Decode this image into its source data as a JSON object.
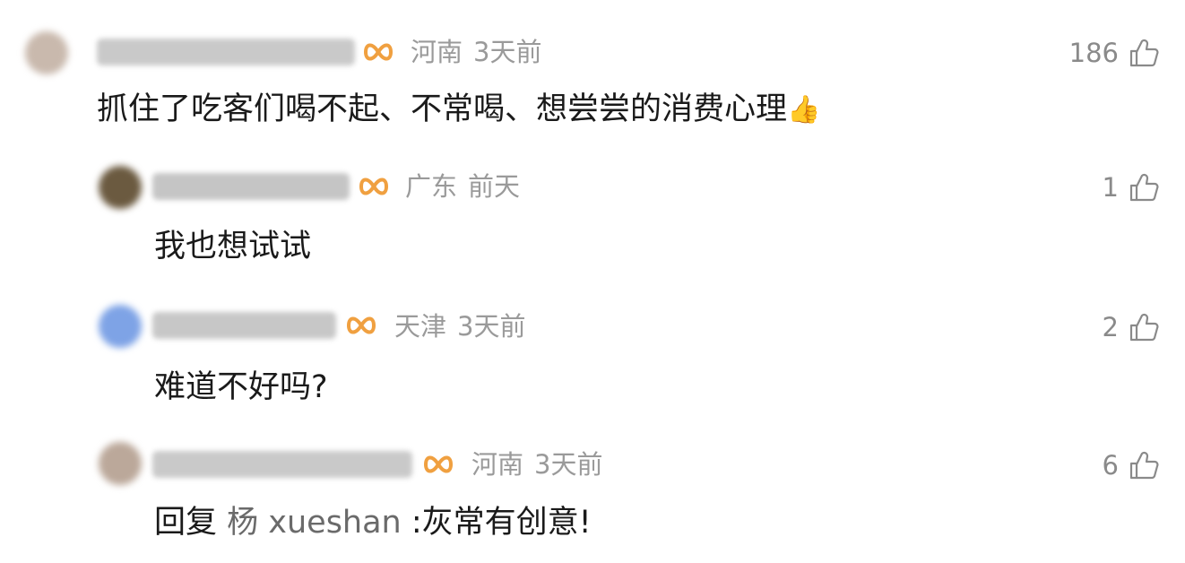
{
  "comments": [
    {
      "location": "河南",
      "time": "3天前",
      "likes": "186",
      "text": "抓住了吃客们喝不起、不常喝、想尝尝的消费心理",
      "emoji": "👍",
      "avatar_color": "#c9b9ad",
      "nick_color": "#b8b8b8"
    },
    {
      "location": "广东",
      "time": "前天",
      "likes": "1",
      "text": "我也想试试",
      "avatar_color": "#6b5a40",
      "nick_color": "#b2b2b2"
    },
    {
      "location": "天津",
      "time": "3天前",
      "likes": "2",
      "text": "难道不好吗?",
      "avatar_color": "#7ea3e6",
      "nick_color": "#b5b5b5"
    },
    {
      "location": "河南",
      "time": "3天前",
      "likes": "6",
      "reply_prefix": "回复 ",
      "reply_to": "杨 xueshan",
      "text": " :灰常有创意!",
      "avatar_color": "#bba89a",
      "nick_color": "#b8b8b8"
    }
  ],
  "colors": {
    "badge": "#f0a040",
    "meta_text": "#9a9a9a",
    "body_text": "#1a1a1a"
  },
  "icons": {
    "badge": "infinity-badge-icon",
    "like": "thumbs-up-outline-icon"
  }
}
